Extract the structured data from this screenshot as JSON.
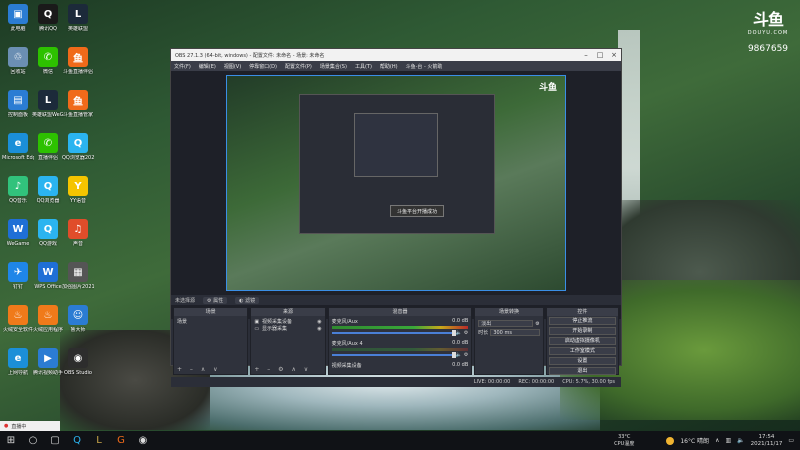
{
  "desktop": {
    "icons": [
      {
        "label": "此电脑",
        "glyph": "▣",
        "color": "#2b7cd3"
      },
      {
        "label": "腾讯QQ",
        "glyph": "Q",
        "color": "#1a1a1a"
      },
      {
        "label": "英雄联盟",
        "glyph": "L",
        "color": "#1c2a3a"
      },
      {
        "label": "回收站",
        "glyph": "♲",
        "color": "#6b8fb3"
      },
      {
        "label": "微信",
        "glyph": "✆",
        "color": "#2dc100"
      },
      {
        "label": "斗鱼直播伴侣",
        "glyph": "鱼",
        "color": "#f06a1a"
      },
      {
        "label": "控制面板",
        "glyph": "▤",
        "color": "#2b7cd3"
      },
      {
        "label": "英雄联盟WeGame版",
        "glyph": "L",
        "color": "#1c2a3a"
      },
      {
        "label": "斗鱼直播管家",
        "glyph": "鱼",
        "color": "#f06a1a"
      },
      {
        "label": "Microsoft Edge",
        "glyph": "e",
        "color": "#1b8fd8"
      },
      {
        "label": "直播伴侣",
        "glyph": "✆",
        "color": "#2dc100"
      },
      {
        "label": "QQ浏览器2021100...",
        "glyph": "Q",
        "color": "#2bb4f0"
      },
      {
        "label": "QQ音乐",
        "glyph": "♪",
        "color": "#31c27c"
      },
      {
        "label": "QQ浏览器",
        "glyph": "Q",
        "color": "#2bb4f0"
      },
      {
        "label": "YY语音",
        "glyph": "Y",
        "color": "#f5c400"
      },
      {
        "label": "WeGame",
        "glyph": "W",
        "color": "#1f6fd6"
      },
      {
        "label": "QQ游戏",
        "glyph": "Q",
        "color": "#2bb4f0"
      },
      {
        "label": "声音",
        "glyph": "♫",
        "color": "#e04d2a"
      },
      {
        "label": "钉钉",
        "glyph": "✈",
        "color": "#1f86e8"
      },
      {
        "label": "WPS Office",
        "glyph": "W",
        "color": "#1f6fd6"
      },
      {
        "label": "加强图片2021...",
        "glyph": "▦",
        "color": "#555"
      },
      {
        "label": "火绒安全软件",
        "glyph": "♨",
        "color": "#f07a1a"
      },
      {
        "label": "火绒应用程序",
        "glyph": "♨",
        "color": "#f07a1a"
      },
      {
        "label": "鲁大师",
        "glyph": "☺",
        "color": "#2b7cd3"
      },
      {
        "label": "上网导航",
        "glyph": "e",
        "color": "#1b8fd8"
      },
      {
        "label": "腾讯视频助手",
        "glyph": "▶",
        "color": "#2b7cd3"
      },
      {
        "label": "OBS Studio",
        "glyph": "◉",
        "color": "#2d2d2d"
      }
    ]
  },
  "douyu": {
    "logo": "斗鱼",
    "sub": "DOUYU.COM",
    "room_id": "9867659"
  },
  "obs": {
    "title": "OBS 27.1.3 (64-bit, windows) - 配置文件: 未命名 - 场景: 未命名",
    "menu": [
      "文件(F)",
      "编辑(E)",
      "视图(V)",
      "停靠窗口(D)",
      "配置文件(P)",
      "场景集合(S)",
      "工具(T)",
      "帮助(H)",
      "斗鱼-台 - 火箭助"
    ],
    "nested_toast": "斗鱼平台开播成功",
    "preview_logo": "斗鱼",
    "scene_bar": {
      "label": "未选择源",
      "props": "属性",
      "filters": "滤镜"
    },
    "scenes": {
      "header": "场景",
      "items": [
        "场景"
      ]
    },
    "sources": {
      "header": "来源",
      "items": [
        "视频采集设备",
        "显示器采集"
      ]
    },
    "mixer": {
      "header": "混音器",
      "channels": [
        {
          "name": "麦克风/Aux",
          "db": "0.0 dB"
        },
        {
          "name": "麦克风/Aux 4",
          "db": "0.0 dB"
        },
        {
          "name": "视频采集设备",
          "db": "0.0 dB"
        }
      ]
    },
    "transitions": {
      "header": "场景转换",
      "type": "淡出",
      "duration_label": "时长",
      "duration": "300 ms"
    },
    "controls": {
      "header": "控件",
      "buttons": [
        "停止推流",
        "开始录制",
        "启动虚拟摄像机",
        "工作室模式",
        "设置",
        "退出"
      ]
    },
    "status": {
      "live": "LIVE: 00:00:00",
      "rec": "REC: 00:00:00",
      "cpu": "CPU: 5.7%, 30.00 fps"
    }
  },
  "taskbar": {
    "notif": "直播中",
    "weather": "16°C 晴朗",
    "cpu_temp": "33°C",
    "cpu_label": "CPU温度",
    "time": "17:54",
    "date": "2021/11/17"
  }
}
